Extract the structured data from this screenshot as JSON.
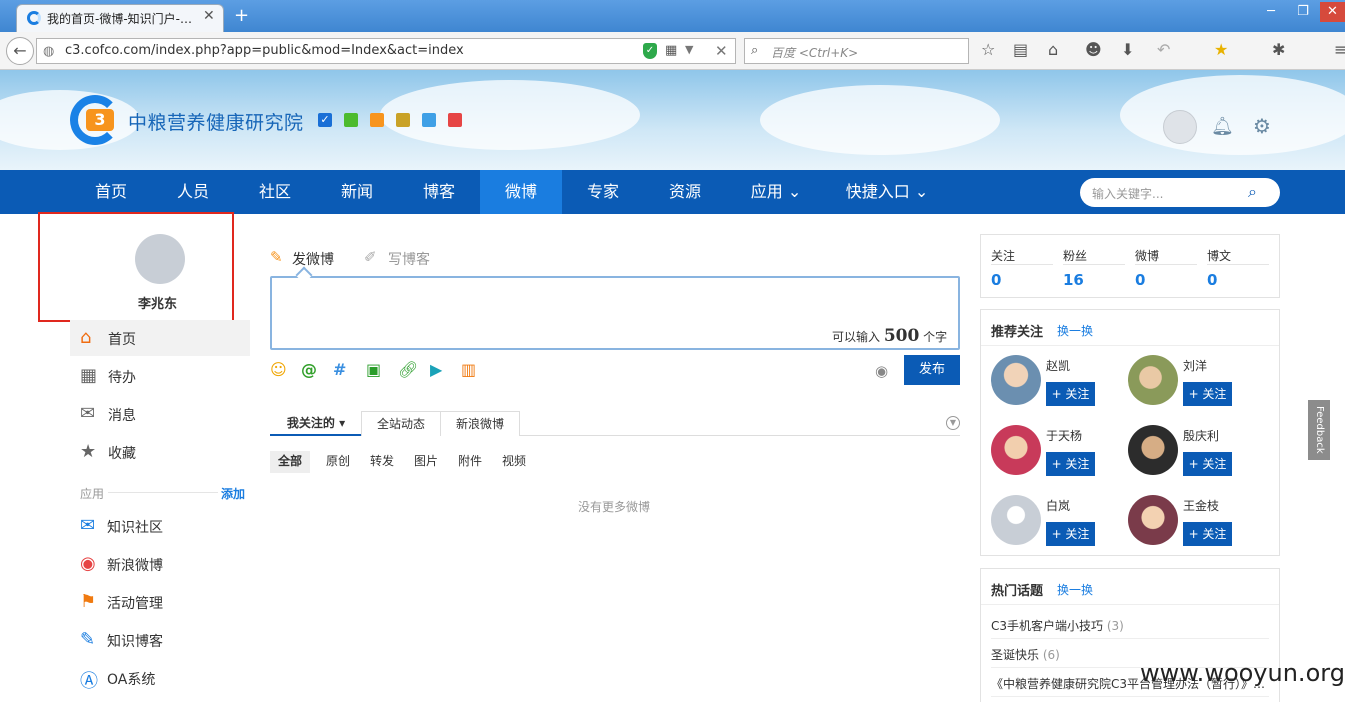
{
  "browser": {
    "tab_title": "我的首页-微博-知识门户-…",
    "tab_close": "✕",
    "new_tab": "+",
    "url": "c3.cofco.com/index.php?app=public&mod=Index&act=index",
    "search_placeholder": "百度 <Ctrl+K>",
    "win_min": "─",
    "win_restore": "❐",
    "win_close": "✕"
  },
  "header": {
    "logo_text": "中粮营养健康研究院",
    "logo_mark": "3",
    "swatch_check": "✓",
    "swatch_colors": [
      "#1a6fd6",
      "#4cbb2e",
      "#f7941d",
      "#c9a227",
      "#3fa0e6",
      "#e64545"
    ]
  },
  "nav": {
    "items": [
      "首页",
      "人员",
      "社区",
      "新闻",
      "博客",
      "微博",
      "专家",
      "资源",
      "应用 ⌄",
      "快捷入口 ⌄"
    ],
    "active_index": 5,
    "search_placeholder": "输入关键字..."
  },
  "sidebar": {
    "user_name": "李兆东",
    "items": [
      {
        "label": "首页",
        "icon": "home-icon"
      },
      {
        "label": "待办",
        "icon": "calendar-icon"
      },
      {
        "label": "消息",
        "icon": "mail-icon"
      },
      {
        "label": "收藏",
        "icon": "star-icon"
      }
    ],
    "apps_label": "应用",
    "apps_add": "添加",
    "apps": [
      {
        "label": "知识社区",
        "icon": "chat-icon"
      },
      {
        "label": "新浪微博",
        "icon": "weibo-icon"
      },
      {
        "label": "活动管理",
        "icon": "flag-icon"
      },
      {
        "label": "知识博客",
        "icon": "blog-icon"
      },
      {
        "label": "OA系统",
        "icon": "oa-icon"
      }
    ]
  },
  "composer": {
    "tab_post": "发微博",
    "tab_blog": "写博客",
    "count_prefix": "可以输入",
    "count_value": "500",
    "count_suffix": "个字",
    "publish": "发布"
  },
  "feed": {
    "tabs": [
      "我关注的 ▾",
      "全站动态",
      "新浪微博"
    ],
    "filters": [
      "全部",
      "原创",
      "转发",
      "图片",
      "附件",
      "视频"
    ],
    "empty_text": "没有更多微博"
  },
  "stats": [
    {
      "label": "关注",
      "value": "0"
    },
    {
      "label": "粉丝",
      "value": "16"
    },
    {
      "label": "微博",
      "value": "0"
    },
    {
      "label": "博文",
      "value": "0"
    }
  ],
  "recommend": {
    "title": "推荐关注",
    "refresh": "换一换",
    "follow_label": "+ 关注",
    "people": [
      "赵凯",
      "刘洋",
      "于天杨",
      "殷庆利",
      "白岚",
      "王金枝"
    ]
  },
  "topics": {
    "title": "热门话题",
    "refresh": "换一换",
    "items": [
      {
        "text": "C3手机客户端小技巧",
        "count": "(3)"
      },
      {
        "text": "圣诞快乐",
        "count": "(6)"
      },
      {
        "text": "《中粮营养健康研究院C3平台管理办法（暂行）》…",
        "count": ""
      }
    ]
  },
  "feedback": "Feedback",
  "watermark": "www.wooyun.org"
}
